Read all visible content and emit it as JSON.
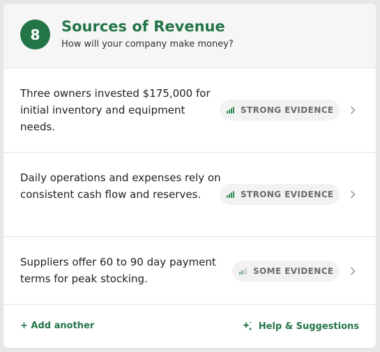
{
  "header": {
    "step_number": "8",
    "title": "Sources of Revenue",
    "subtitle": "How will your company make money?"
  },
  "items": [
    {
      "text": "Three owners invested $175,000 for initial inventory and equipment needs.",
      "evidence": "STRONG EVIDENCE",
      "evidence_level": "strong",
      "icon": "signal-bars-icon"
    },
    {
      "text": "Daily operations and expenses rely on consistent cash flow and reserves.",
      "evidence": "STRONG EVIDENCE",
      "evidence_level": "strong",
      "icon": "signal-bars-icon"
    },
    {
      "text": "Suppliers offer 60 to 90 day payment terms for peak stocking.",
      "evidence": "SOME EVIDENCE",
      "evidence_level": "some",
      "icon": "signal-bars-icon"
    }
  ],
  "footer": {
    "add_label": "+ Add another",
    "help_label": "Help & Suggestions",
    "help_icon": "sparkle-icon"
  },
  "colors": {
    "accent": "#237548",
    "header_bg": "#f6f6f6",
    "badge_bg": "#f2f2f2",
    "badge_text": "#6b6b6b"
  }
}
